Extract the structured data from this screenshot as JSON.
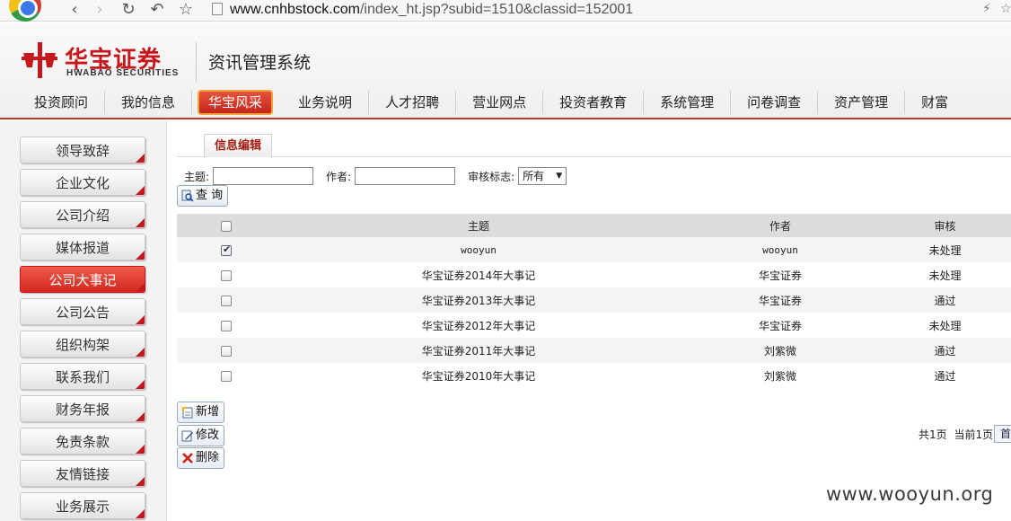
{
  "browser": {
    "url_host": "www.cnhbstock.com",
    "url_path": "/index_ht.jsp?subid=1510&classid=152001"
  },
  "header": {
    "logo_cn": "华宝证券",
    "logo_en": "HWABAO SECURITIES",
    "system_title": "资讯管理系统",
    "nav": [
      "投资顾问",
      "我的信息",
      "华宝风采",
      "业务说明",
      "人才招聘",
      "营业网点",
      "投资者教育",
      "系统管理",
      "问卷调查",
      "资产管理",
      "财富"
    ],
    "active_nav": "华宝风采",
    "brand_color": "#c8161d"
  },
  "sidebar": {
    "items": [
      "领导致辞",
      "企业文化",
      "公司介绍",
      "媒体报道",
      "公司大事记",
      "公司公告",
      "组织构架",
      "联系我们",
      "财务年报",
      "免责条款",
      "友情链接",
      "业务展示"
    ],
    "active": "公司大事记"
  },
  "main": {
    "tab_label": "信息编辑",
    "filters": {
      "subject_label": "主题:",
      "subject_value": "",
      "author_label": "作者:",
      "author_value": "",
      "review_label": "审核标志:",
      "review_value": "所有"
    },
    "query_button": "查 询",
    "table": {
      "headers": [
        "",
        "主题",
        "作者",
        "审核"
      ],
      "rows": [
        {
          "checked": true,
          "subject": "wooyun",
          "author": "wooyun",
          "status": "未处理"
        },
        {
          "checked": false,
          "subject": "华宝证券2014年大事记",
          "author": "华宝证券",
          "status": "未处理"
        },
        {
          "checked": false,
          "subject": "华宝证券2013年大事记",
          "author": "华宝证券",
          "status": "通过"
        },
        {
          "checked": false,
          "subject": "华宝证券2012年大事记",
          "author": "华宝证券",
          "status": "未处理"
        },
        {
          "checked": false,
          "subject": "华宝证券2011年大事记",
          "author": "刘紫微",
          "status": "通过"
        },
        {
          "checked": false,
          "subject": "华宝证券2010年大事记",
          "author": "刘紫微",
          "status": "通过"
        }
      ]
    },
    "actions": {
      "add": "新增",
      "edit": "修改",
      "delete": "删除"
    },
    "pager": {
      "total_pages": "共1页",
      "current_page": "当前1页",
      "first_button": "首"
    }
  },
  "watermark": "www.wooyun.org"
}
